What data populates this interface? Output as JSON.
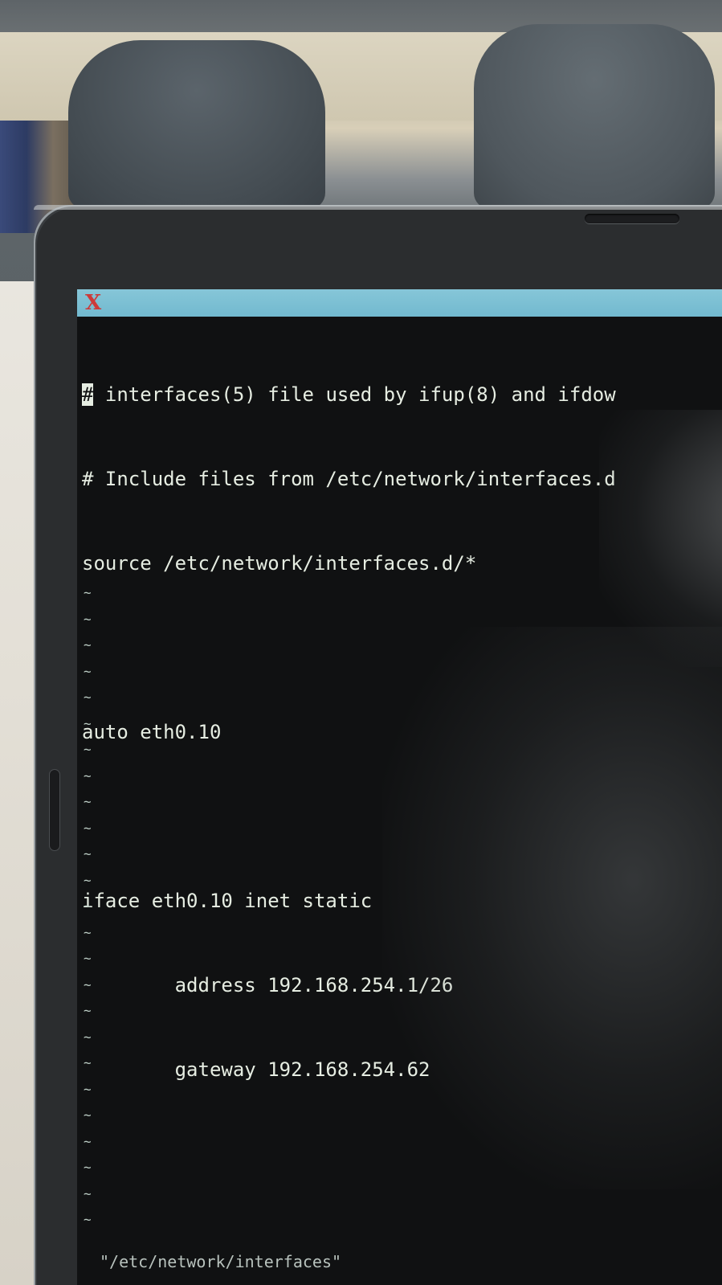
{
  "editor": {
    "window_logo": "X",
    "lines": [
      {
        "prefix": "#",
        "text": " interfaces(5) file used by ifup(8) and ifdow"
      },
      {
        "prefix": "",
        "text": "# Include files from /etc/network/interfaces.d"
      },
      {
        "prefix": "",
        "text": "source /etc/network/interfaces.d/*"
      },
      {
        "prefix": "",
        "text": ""
      },
      {
        "prefix": "",
        "text": "auto eth0.10"
      },
      {
        "prefix": "",
        "text": ""
      },
      {
        "prefix": "",
        "text": "iface eth0.10 inet static"
      },
      {
        "prefix": "",
        "text": "        address 192.168.254.1/26"
      },
      {
        "prefix": "",
        "text": "        gateway 192.168.254.62"
      }
    ],
    "empty_line_marker": "~",
    "status_line": "\"/etc/network/interfaces\""
  },
  "colors": {
    "titlebar": "#7cc0d4",
    "screen_background": "#101112",
    "text": "#e6ede2",
    "logo": "#cc3a3a"
  }
}
